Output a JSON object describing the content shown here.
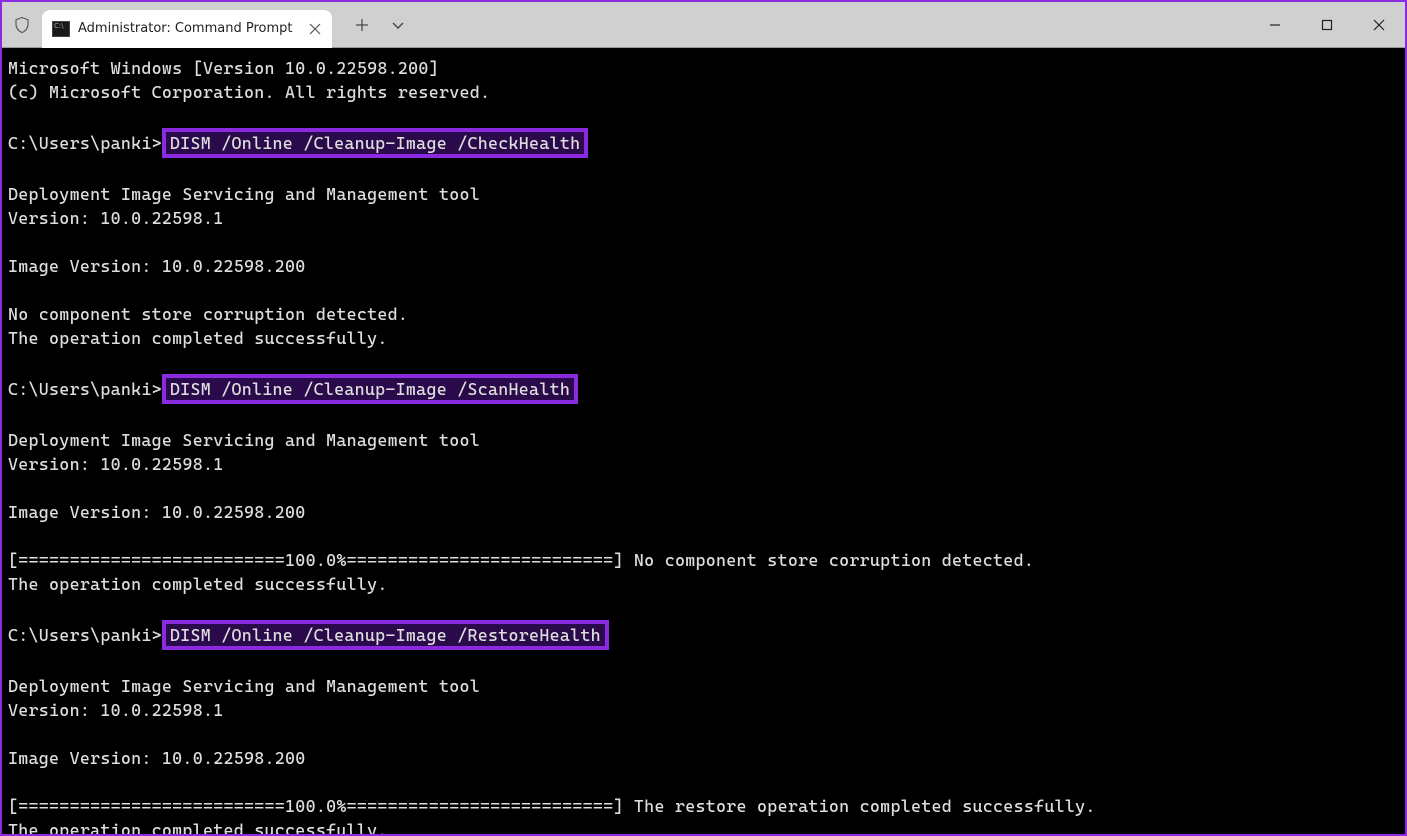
{
  "tab": {
    "title": "Administrator: Command Prompt"
  },
  "prompt": "C:\\Users\\panki>",
  "cmd1": "DISM /Online /Cleanup-Image /CheckHealth",
  "cmd2": "DISM /Online /Cleanup-Image /ScanHealth",
  "cmd3": "DISM /Online /Cleanup-Image /RestoreHealth",
  "lines": {
    "ver1": "Microsoft Windows [Version 10.0.22598.200]",
    "ver2": "(c) Microsoft Corporation. All rights reserved.",
    "dismTool": "Deployment Image Servicing and Management tool",
    "dismVer": "Version: 10.0.22598.1",
    "imgVer": "Image Version: 10.0.22598.200",
    "noCorrupt": "No component store corruption detected.",
    "opOk": "The operation completed successfully.",
    "progressScan": "[==========================100.0%==========================] No component store corruption detected.",
    "progressRestore": "[==========================100.0%==========================] The restore operation completed successfully."
  }
}
